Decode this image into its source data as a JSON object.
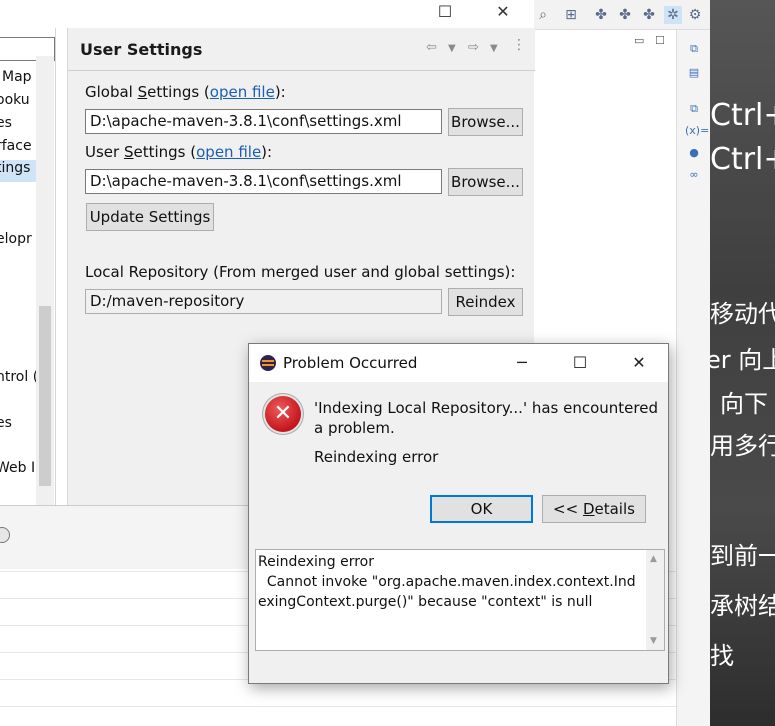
{
  "preferences": {
    "tree": {
      "items": [
        "Map",
        "ooku",
        "es",
        "rface",
        "tings",
        "elopr",
        "ntrol (",
        "es",
        "Web I"
      ],
      "selected_index": 4
    },
    "page": {
      "title": "User Settings",
      "global_settings": {
        "label_prefix": "Global ",
        "label_mnemonic": "S",
        "label_rest": "ettings (",
        "link": "open file",
        "label_suffix": "):",
        "value": "D:\\apache-maven-3.8.1\\conf\\settings.xml",
        "browse": "Browse..."
      },
      "user_settings": {
        "label_prefix": "User ",
        "label_mnemonic": "S",
        "label_rest": "ettings (",
        "link": "open file",
        "label_suffix": "):",
        "value": "D:\\apache-maven-3.8.1\\conf\\settings.xml",
        "browse": "Browse..."
      },
      "update_button": "Update Settings",
      "local_repo": {
        "label": "Local Repository (From merged user and global settings):",
        "value": "D:/maven-repository",
        "reindex": "Reindex"
      }
    }
  },
  "dialog": {
    "title": "Problem Occurred",
    "message": "'Indexing Local Repository...' has encountered a problem.",
    "submessage": "Reindexing error",
    "ok": "OK",
    "details_prefix": "<< ",
    "details_mnemonic": "D",
    "details_rest": "etails",
    "details_text": "Reindexing error\n  Cannot invoke \"org.apache.maven.index.context.IndexingContext.purge()\" because \"context\" is null"
  },
  "wallpaper": {
    "lines": [
      "Ctrl+",
      "Ctrl+",
      "移动代",
      "er 向上",
      "向下",
      "用多行",
      "到前一",
      "承树结",
      "找"
    ]
  },
  "icons": {
    "error": "error-x-icon",
    "minimize": "minimize-icon",
    "maximize": "maximize-icon",
    "close": "close-icon"
  }
}
